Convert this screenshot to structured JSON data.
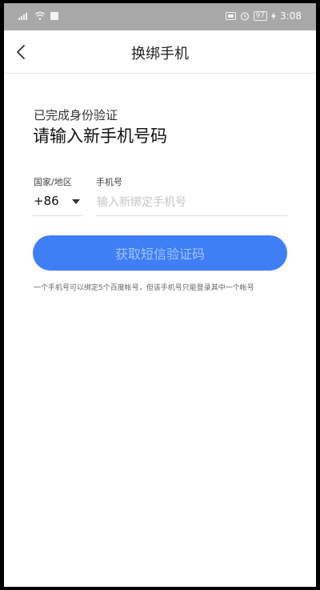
{
  "status_bar": {
    "left_icons": [
      "signal-icon",
      "wifi-icon",
      "app-notification-icon"
    ],
    "right_icons": [
      "hd-icon",
      "alarm-icon"
    ],
    "battery": "97",
    "time": "3:08"
  },
  "nav": {
    "title": "换绑手机"
  },
  "content": {
    "verified": "已完成身份验证",
    "heading": "请输入新手机号码",
    "country_label": "国家/地区",
    "country_code": "+86",
    "phone_label": "手机号",
    "phone_placeholder": "输入新绑定手机号",
    "phone_value": "",
    "button_label": "获取短信验证码",
    "note": "一个手机号可以绑定5个百度帐号，但该手机号只能登录其中一个帐号"
  },
  "colors": {
    "accent": "#3f7ff5",
    "button_text": "#9fc1ff",
    "status_bar_bg": "#a8a8a8"
  }
}
